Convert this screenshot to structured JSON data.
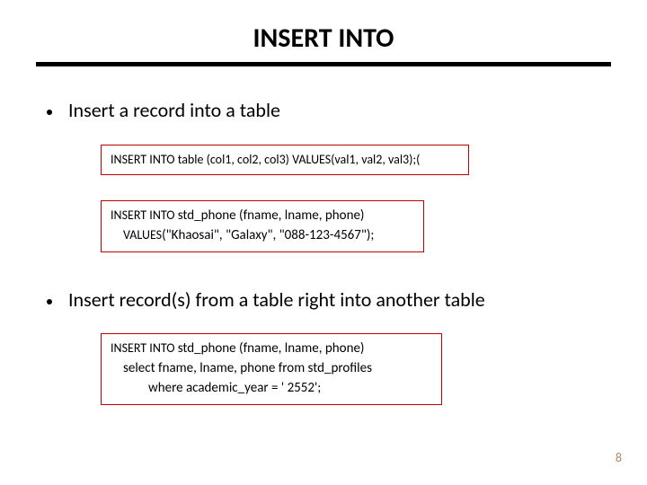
{
  "title": "INSERT INTO",
  "bullets": {
    "b1": "Insert a record into a table",
    "b2": "Insert record(s) from a table right into another table"
  },
  "code": {
    "syntax": "INSERT  INTO  table (col1, col2, col3)  VALUES(val1,  val2,  val3);(",
    "ex1_kw1": "INSERT  INTO ",
    "ex1_rest1": " std_phone (fname, lname, phone)",
    "ex1_kw2": "VALUES",
    "ex1_rest2": "(\"Khaosai\", \"Galaxy\", \"088-123-4567\");",
    "ex2_kw1": "INSERT  INTO ",
    "ex2_rest1": " std_phone (fname,  lname, phone)",
    "ex2_line2": "select  fname,  lname,  phone  from  std_profiles",
    "ex2_line3": "where  academic_year = ' 2552';"
  },
  "page_number": "8"
}
